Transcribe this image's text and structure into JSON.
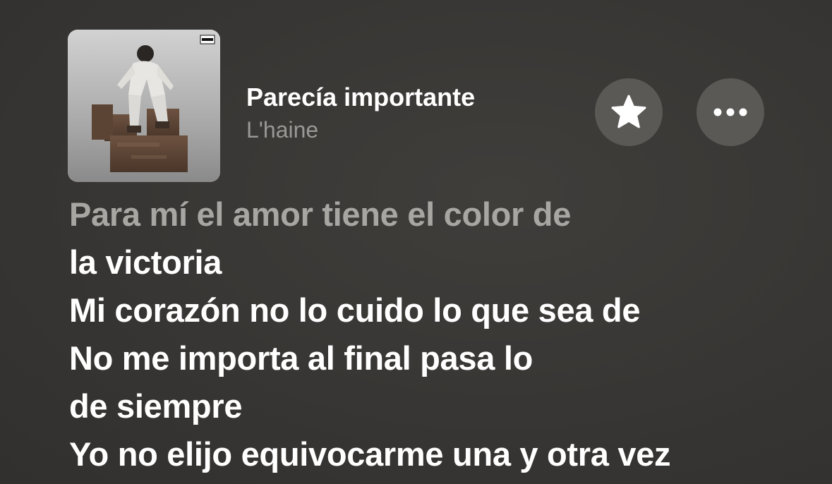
{
  "track": {
    "title": "Parecía importante",
    "artist": "L'haine",
    "advisory_label": "PARENTAL ADVISORY EXPLICIT CONTENT"
  },
  "controls": {
    "favorite_icon": "star-icon",
    "more_icon": "ellipsis-icon"
  },
  "lyrics": [
    {
      "text": "Para mí el amor tiene el color de",
      "state": "past"
    },
    {
      "text": "la victoria",
      "state": "current"
    },
    {
      "text": "Mi corazón no lo cuido lo que sea de",
      "state": "current"
    },
    {
      "text": "No me importa al final pasa lo",
      "state": "current"
    },
    {
      "text": "de siempre",
      "state": "current"
    },
    {
      "text": "Yo no elijo equivocarme una y otra vez",
      "state": "current"
    }
  ],
  "colors": {
    "background": "#3a3836",
    "text_primary": "#ffffff",
    "text_secondary": "#9a9896",
    "button_bg": "#5b5956"
  }
}
